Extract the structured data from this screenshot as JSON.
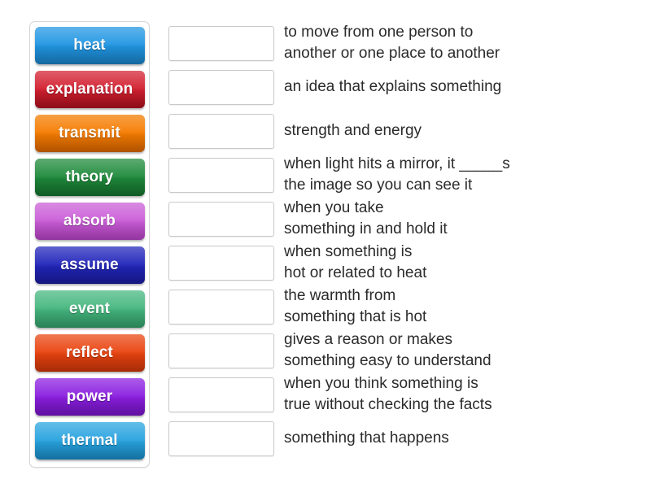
{
  "activity": {
    "type": "match-up",
    "tray_label": "word-tiles"
  },
  "tiles": [
    {
      "label": "heat",
      "color": "#2196e3",
      "color_dark": "#1b86cc"
    },
    {
      "label": "explanation",
      "color": "#d32030",
      "color_dark": "#b3101f"
    },
    {
      "label": "transmit",
      "color": "#f57c00",
      "color_dark": "#e06a00"
    },
    {
      "label": "theory",
      "color": "#1f8b3c",
      "color_dark": "#15752f"
    },
    {
      "label": "absorb",
      "color": "#cb5ed8",
      "color_dark": "#bb44ca"
    },
    {
      "label": "assume",
      "color": "#2226bb",
      "color_dark": "#1a1da3"
    },
    {
      "label": "event",
      "color": "#46b77f",
      "color_dark": "#35a56d"
    },
    {
      "label": "reflect",
      "color": "#ea4410",
      "color_dark": "#d3380a"
    },
    {
      "label": "power",
      "color": "#8b1fe0",
      "color_dark": "#7a14cc"
    },
    {
      "label": "thermal",
      "color": "#28a4e0",
      "color_dark": "#1b90cc"
    }
  ],
  "rows": [
    {
      "definition": "to move from one person to\nanother or one place to another"
    },
    {
      "definition": "an idea that explains something"
    },
    {
      "definition": "strength and energy"
    },
    {
      "definition": "when light hits a mirror, it _____s\nthe image so you can see it"
    },
    {
      "definition": "when you take\nsomething in and hold it"
    },
    {
      "definition": "when something is\nhot or related to heat"
    },
    {
      "definition": "the warmth from\nsomething that is hot"
    },
    {
      "definition": "gives a reason or makes\nsomething easy to understand"
    },
    {
      "definition": "when you think something is\ntrue without checking the facts"
    },
    {
      "definition": "something that happens"
    }
  ]
}
